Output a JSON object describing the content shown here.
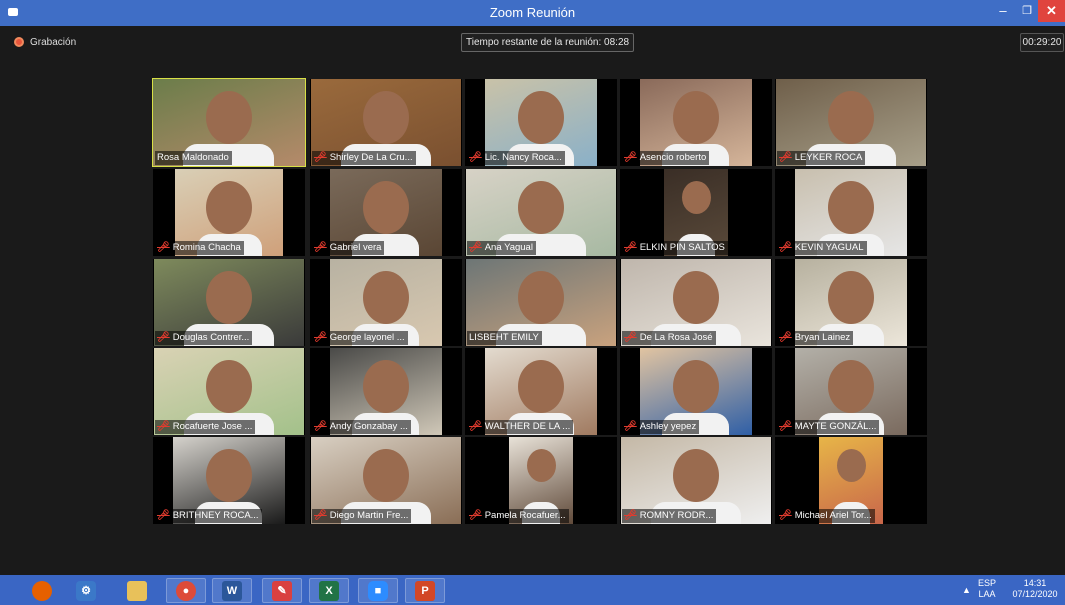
{
  "window": {
    "title": "Zoom Reunión"
  },
  "meeting": {
    "recording_label": "Grabación",
    "remaining_time": "Tiempo restante de la reunión: 08:28",
    "elapsed": "00:29:20"
  },
  "participants": [
    {
      "name": "Rosa Maldonado",
      "muted": false,
      "active": true
    },
    {
      "name": "Shirley De La Cru...",
      "muted": true
    },
    {
      "name": "Lic. Nancy Roca...",
      "muted": true
    },
    {
      "name": "Asencio roberto",
      "muted": true
    },
    {
      "name": "LEYKER  ROCA",
      "muted": true
    },
    {
      "name": "Romina Chacha",
      "muted": true
    },
    {
      "name": "Gabriel vera",
      "muted": true
    },
    {
      "name": "Ana Yagual",
      "muted": true
    },
    {
      "name": "ELKIN PIN SALTOS",
      "muted": true
    },
    {
      "name": "KEVIN YAGUAL",
      "muted": true
    },
    {
      "name": "Douglas Contrer...",
      "muted": true
    },
    {
      "name": "George layonel ...",
      "muted": true
    },
    {
      "name": "LISBEHT EMILY",
      "muted": false
    },
    {
      "name": "De La Rosa José",
      "muted": true
    },
    {
      "name": "Bryan Lainez",
      "muted": true
    },
    {
      "name": "Rocafuerte Jose ...",
      "muted": true
    },
    {
      "name": "Andy Gonzabay ...",
      "muted": true
    },
    {
      "name": "WALTHER DE LA ...",
      "muted": true
    },
    {
      "name": "Ashley yepez",
      "muted": true
    },
    {
      "name": "MAYTE GONZÁL...",
      "muted": true
    },
    {
      "name": "BRITHNEY ROCA...",
      "muted": true
    },
    {
      "name": "Diego Martin Fre...",
      "muted": true
    },
    {
      "name": "Pamela Rocafuer...",
      "muted": true
    },
    {
      "name": "ROMNY RODR...",
      "muted": true
    },
    {
      "name": "Michael Ariel Tor...",
      "muted": true
    }
  ],
  "taskbar": {
    "apps": [
      "firefox-icon",
      "file-explorer-icon",
      "folder-icon",
      "chrome-icon",
      "word-icon",
      "paint-icon",
      "excel-icon",
      "zoom-icon",
      "powerpoint-icon"
    ],
    "language": "ESP",
    "layout": "LAA",
    "time": "14:31",
    "date": "07/12/2020"
  },
  "colors": {
    "titlebar": "#3f6ec6",
    "active_speaker": "#d8e046",
    "muted": "#e23b2e",
    "taskbar": "#3a66c4"
  }
}
